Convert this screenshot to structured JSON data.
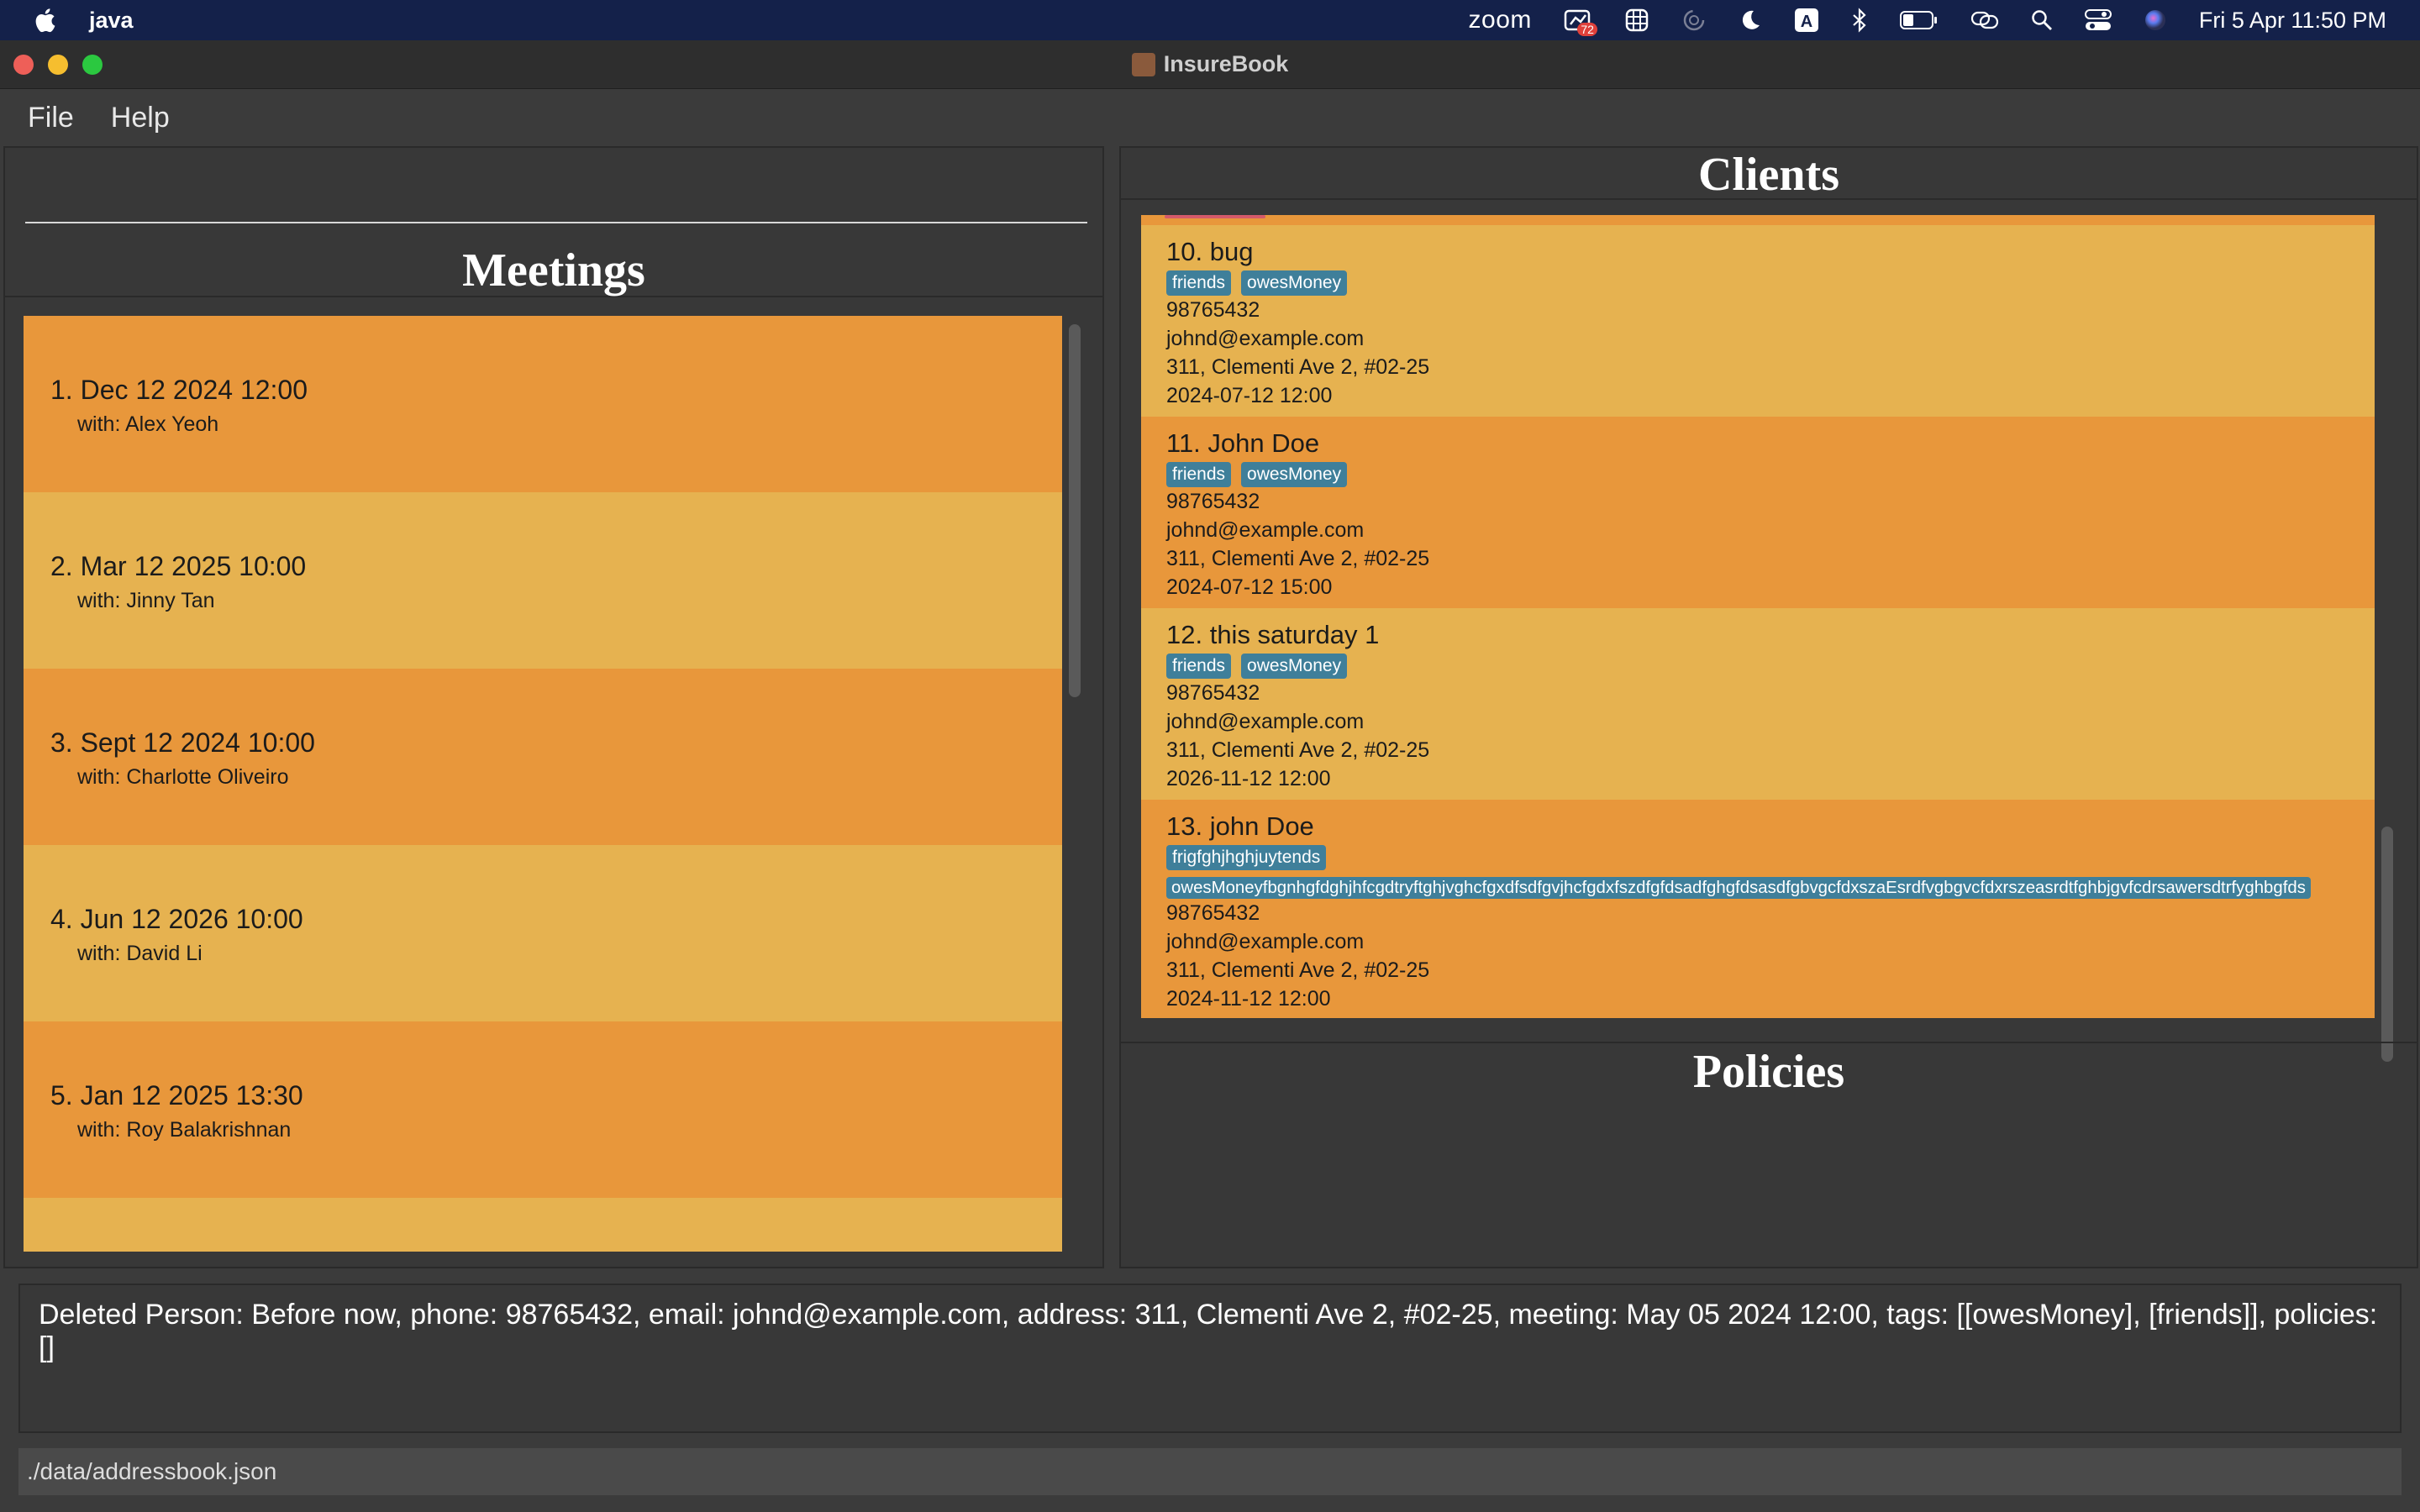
{
  "mac_menu": {
    "app_name": "java",
    "zoom_label": "zoom",
    "notif_badge": "72",
    "datetime": "Fri 5 Apr  11:50 PM"
  },
  "window": {
    "title": "InsureBook"
  },
  "menu": {
    "file": "File",
    "help": "Help"
  },
  "meetings": {
    "title": "Meetings",
    "items": [
      {
        "date": "1.  Dec 12 2024 12:00",
        "with": "with: Alex Yeoh"
      },
      {
        "date": "2.  Mar 12 2025 10:00",
        "with": "with: Jinny Tan"
      },
      {
        "date": "3.  Sept 12 2024 10:00",
        "with": "with: Charlotte Oliveiro"
      },
      {
        "date": "4.  Jun 12 2026 10:00",
        "with": "with: David Li"
      },
      {
        "date": "5.  Jan 12 2025 13:30",
        "with": "with: Roy Balakrishnan"
      }
    ]
  },
  "clients": {
    "title": "Clients",
    "items": [
      {
        "name": "10.  bug",
        "tags": [
          "friends",
          "owesMoney"
        ],
        "phone": "98765432",
        "email": "johnd@example.com",
        "address": "311, Clementi Ave 2, #02-25",
        "meeting": "2024-07-12 12:00"
      },
      {
        "name": "11.  John Doe",
        "tags": [
          "friends",
          "owesMoney"
        ],
        "phone": "98765432",
        "email": "johnd@example.com",
        "address": "311, Clementi Ave 2, #02-25",
        "meeting": "2024-07-12 15:00"
      },
      {
        "name": "12.  this saturday 1",
        "tags": [
          "friends",
          "owesMoney"
        ],
        "phone": "98765432",
        "email": "johnd@example.com",
        "address": "311, Clementi Ave 2, #02-25",
        "meeting": "2026-11-12 12:00"
      },
      {
        "name": "13.  john Doe",
        "tags": [
          "frigfghjhghjuytends",
          "owesMoneyfbgnhgfdghjhfcgdtryftghjvghcfgxdfsdfgvjhcfgdxfszdfgfdsadfghgfdsasdfgbvgcfdxszaEsrdfvgbgvcfdxrszeasrdtfghbjgvfcdrsawersdtrfyghbgfds"
        ],
        "phone": "98765432",
        "email": "johnd@example.com",
        "address": "311, Clementi Ave 2, #02-25",
        "meeting": "2024-11-12 12:00"
      }
    ]
  },
  "policies": {
    "title": "Policies"
  },
  "result": {
    "text": "Deleted Person: Before now, phone: 98765432, email: johnd@example.com, address: 311, Clementi Ave 2, #02-25, meeting: May 05 2024 12:00, tags: [[owesMoney], [friends]], policies: []"
  },
  "status": {
    "path": "./data/addressbook.json"
  },
  "colors": {
    "row_dark": "#e8973b",
    "row_light": "#e6b250",
    "tag_bg": "#3f7f9a",
    "panel_bg": "#383838"
  }
}
